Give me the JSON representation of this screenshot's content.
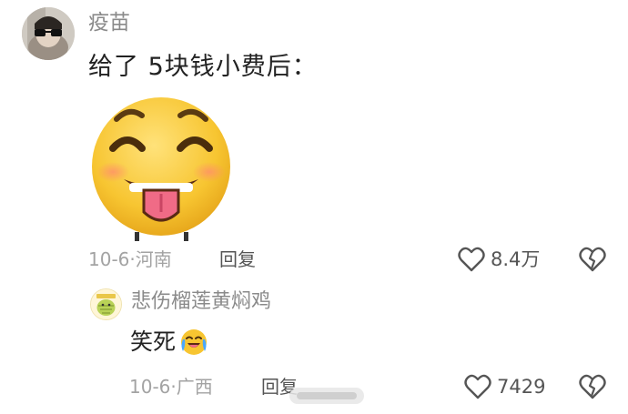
{
  "comment": {
    "username": "疫苗",
    "text": "给了 5块钱小费后：",
    "date": "10-6",
    "location": "河南",
    "reply_label": "回复",
    "likes": "8.4万"
  },
  "reply": {
    "username": "悲伤榴莲黄焖鸡",
    "text": "笑死",
    "date": "10-6",
    "location": "广西",
    "reply_label": "回复",
    "likes": "7429"
  },
  "colors": {
    "meta_gray": "#a3a3a3",
    "username_gray": "#8a8a8a",
    "emoji_yellow": "#f7c531"
  },
  "icons": [
    "heart-outline-icon",
    "broken-heart-icon",
    "laughing-crying-emoji-icon"
  ]
}
